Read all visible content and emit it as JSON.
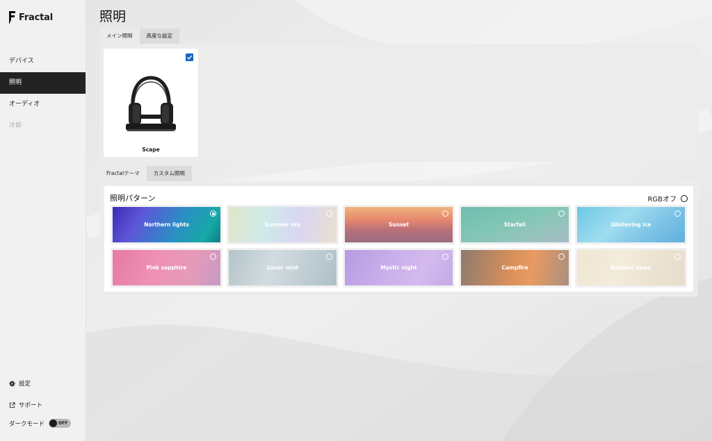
{
  "app": {
    "logo_text": "Fractal"
  },
  "sidebar": {
    "items": [
      {
        "label": "デバイス",
        "state": "normal"
      },
      {
        "label": "照明",
        "state": "active"
      },
      {
        "label": "オーディオ",
        "state": "normal"
      },
      {
        "label": "冷却",
        "state": "disabled"
      }
    ],
    "settings_label": "設定",
    "support_label": "サポート",
    "dark_mode_label": "ダークモード",
    "dark_mode_state": "OFF"
  },
  "page": {
    "title": "照明"
  },
  "device_tabs": [
    {
      "label": "メイン照明",
      "active": true
    },
    {
      "label": "高度な設定",
      "active": false
    }
  ],
  "device": {
    "name": "Scape",
    "checked": true,
    "check_color": "#1565c0"
  },
  "lighting_tabs": [
    {
      "label": "Fractalテーマ",
      "active": true
    },
    {
      "label": "カスタム照明",
      "active": false
    }
  ],
  "lighting": {
    "section_title": "照明パターン",
    "rgb_off_label": "RGBオフ",
    "patterns": [
      {
        "name": "Northern lights",
        "selected": true
      },
      {
        "name": "Summer sky",
        "selected": false
      },
      {
        "name": "Sunset",
        "selected": false
      },
      {
        "name": "Starfall",
        "selected": false
      },
      {
        "name": "Glistening ice",
        "selected": false
      },
      {
        "name": "Pink sapphire",
        "selected": false
      },
      {
        "name": "Lunar mist",
        "selected": false
      },
      {
        "name": "Mystic night",
        "selected": false
      },
      {
        "name": "Campfire",
        "selected": false
      },
      {
        "name": "Radiant dawn",
        "selected": false
      }
    ]
  }
}
